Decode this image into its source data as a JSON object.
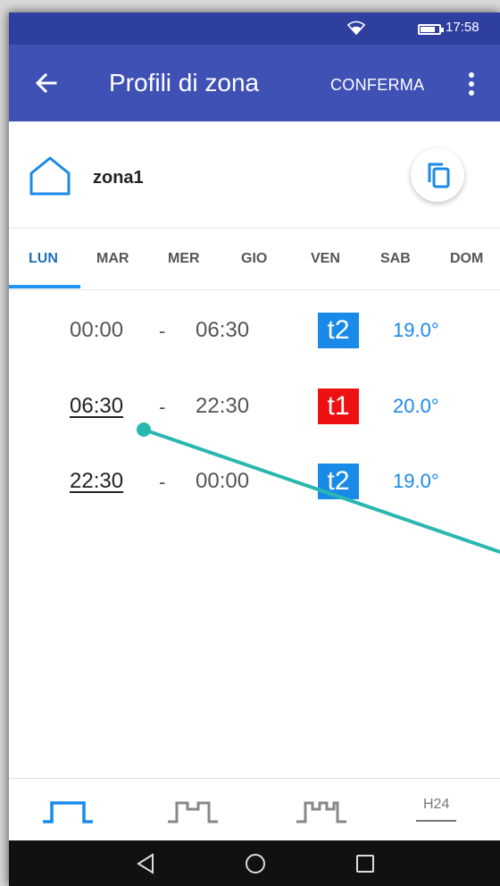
{
  "status_bar": {
    "time": "17:58"
  },
  "app_bar": {
    "title": "Profili di zona",
    "confirm_label": "CONFERMA"
  },
  "zone": {
    "name": "zona1"
  },
  "tabs": [
    {
      "label": "LUN",
      "active": true
    },
    {
      "label": "MAR"
    },
    {
      "label": "MER"
    },
    {
      "label": "GIO"
    },
    {
      "label": "VEN"
    },
    {
      "label": "SAB"
    },
    {
      "label": "DOM"
    }
  ],
  "schedule": [
    {
      "start": "00:00",
      "separator": "-",
      "end": "06:30",
      "level": "t2",
      "level_color": "#1a8ae8",
      "temperature": "19.0°"
    },
    {
      "start": "06:30",
      "separator": "-",
      "end": "22:30",
      "level": "t1",
      "level_color": "#ee1111",
      "temperature": "20.0°"
    },
    {
      "start": "22:30",
      "separator": "-",
      "end": "00:00",
      "level": "t2",
      "level_color": "#1a8ae8",
      "temperature": "19.0°"
    }
  ],
  "bottom_bar": {
    "icons": [
      "single-period-icon",
      "two-period-icon",
      "three-period-icon"
    ],
    "h24_label": "H24"
  },
  "colors": {
    "status_bar": "#2f3fa0",
    "app_bar": "#3f51b5",
    "accent": "#2196f3",
    "annotation_line": "#2ab7b0"
  }
}
